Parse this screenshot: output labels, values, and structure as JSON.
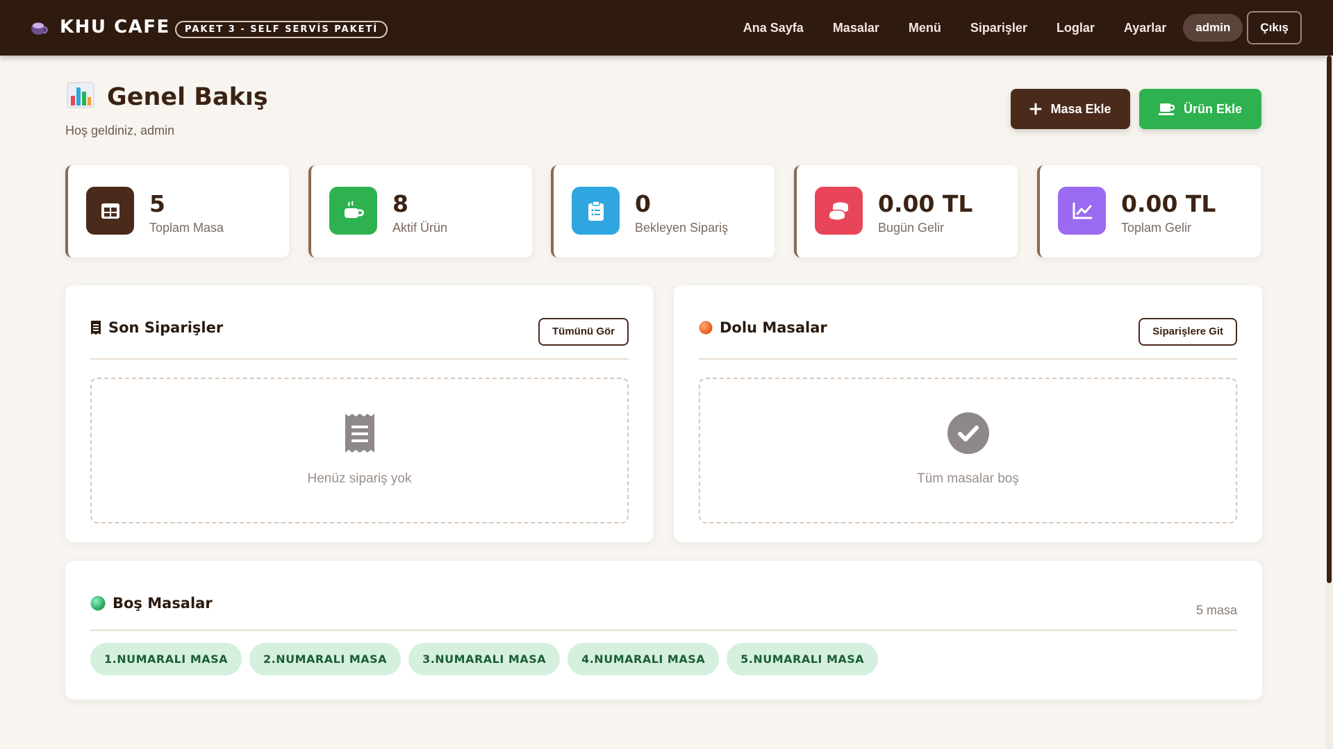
{
  "brand": {
    "title": "KHU CAFE",
    "badge": "PAKET 3 - SELF SERVİS PAKETİ"
  },
  "nav": {
    "items": [
      "Ana Sayfa",
      "Masalar",
      "Menü",
      "Siparişler",
      "Loglar",
      "Ayarlar"
    ],
    "user": "admin",
    "logout": "Çıkış"
  },
  "header": {
    "title": "Genel Bakış",
    "welcome": "Hoş geldiniz, admin",
    "add_table": "Masa Ekle",
    "add_product": "Ürün Ekle"
  },
  "stats": [
    {
      "value": "5",
      "label": "Toplam Masa",
      "color": "#4a2a1b",
      "icon": "table-icon"
    },
    {
      "value": "8",
      "label": "Aktif Ürün",
      "color": "#2eb24f",
      "icon": "coffee-icon"
    },
    {
      "value": "0",
      "label": "Bekleyen Sipariş",
      "color": "#2fa6e0",
      "icon": "clipboard-icon"
    },
    {
      "value": "0.00 TL",
      "label": "Bugün Gelir",
      "color": "#e8455a",
      "icon": "coins-icon"
    },
    {
      "value": "0.00 TL",
      "label": "Toplam Gelir",
      "color": "#9a6af0",
      "icon": "chart-line-icon"
    }
  ],
  "recent_orders": {
    "title": "Son Siparişler",
    "button": "Tümünü Gör",
    "empty": "Henüz sipariş yok"
  },
  "occupied_tables": {
    "title": "Dolu Masalar",
    "button": "Siparişlere Git",
    "empty": "Tüm masalar boş"
  },
  "free_tables": {
    "title": "Boş Masalar",
    "count": "5 masa",
    "tables": [
      "1.NUMARALI MASA",
      "2.NUMARALI MASA",
      "3.NUMARALI MASA",
      "4.NUMARALI MASA",
      "5.NUMARALI MASA"
    ]
  }
}
